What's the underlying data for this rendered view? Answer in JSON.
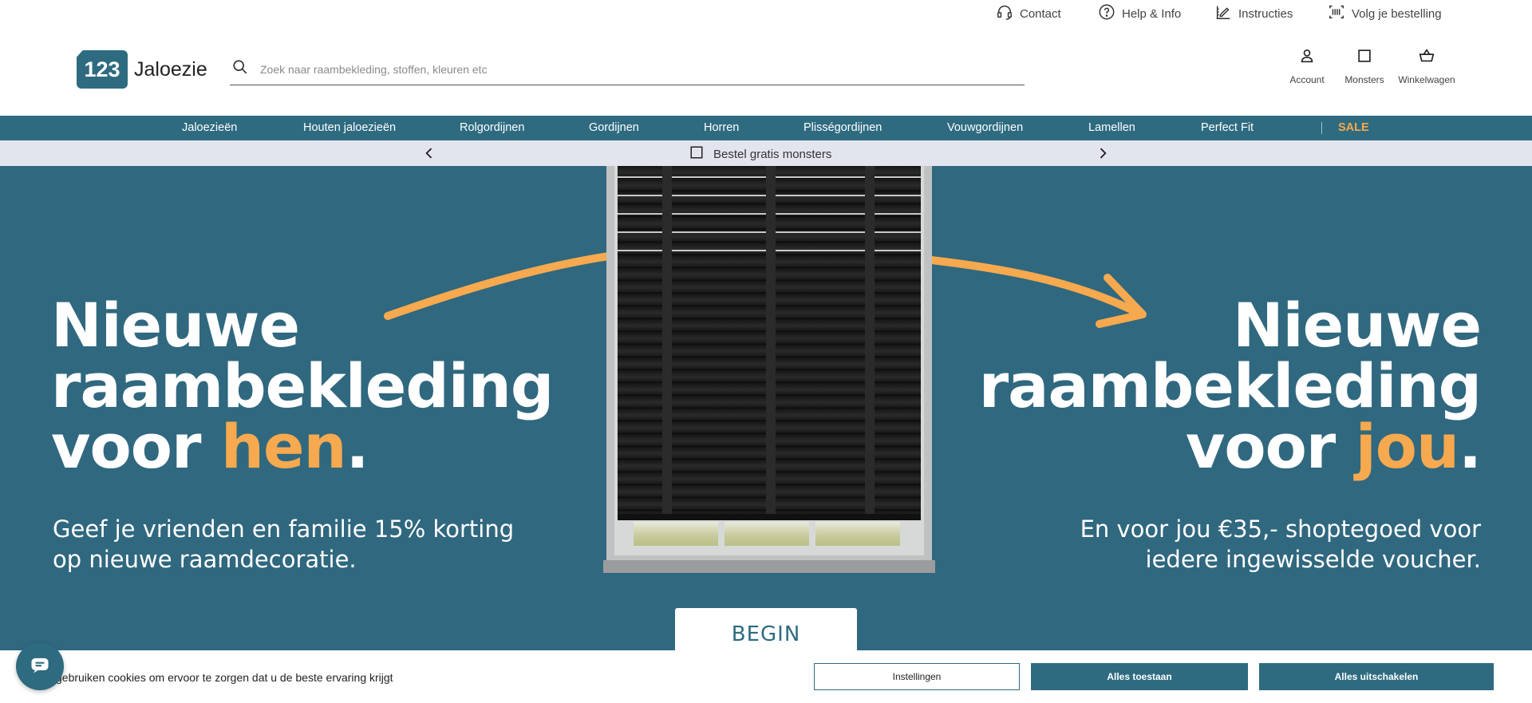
{
  "utility": {
    "contact": "Contact",
    "help": "Help & Info",
    "instructions": "Instructies",
    "track": "Volg je bestelling"
  },
  "header": {
    "logo_number": "123",
    "logo_text": "Jaloezie",
    "search_placeholder": "Zoek naar raambekleding, stoffen, kleuren etc",
    "account": "Account",
    "samples": "Monsters",
    "cart": "Winkelwagen"
  },
  "nav": {
    "items": [
      "Jaloezieën",
      "Houten jaloezieën",
      "Rolgordijnen",
      "Gordijnen",
      "Horren",
      "Plisségordijnen",
      "Vouwgordijnen",
      "Lamellen",
      "Perfect Fit"
    ],
    "sale": "SALE"
  },
  "promo": {
    "text": "Bestel gratis monsters"
  },
  "hero": {
    "left": {
      "line1": "Nieuwe",
      "line2": "raambekleding",
      "line3_prefix": "voor ",
      "line3_accent": "hen",
      "line3_suffix": ".",
      "sub1": "Geef je vrienden en familie 15% korting",
      "sub2": "op nieuwe raamdecoratie."
    },
    "right": {
      "line1": "Nieuwe",
      "line2": "raambekleding",
      "line3_prefix": "voor ",
      "line3_accent": "jou",
      "line3_suffix": ".",
      "sub1": "En voor jou €35,- shoptegoed voor",
      "sub2": "iedere ingewisselde voucher."
    },
    "cta": "BEGIN"
  },
  "cookie": {
    "text": "gebruiken cookies om ervoor te zorgen dat u de beste ervaring krijgt",
    "settings": "Instellingen",
    "allow_all": "Alles toestaan",
    "disable_all": "Alles uitschakelen"
  },
  "colors": {
    "brand": "#2e6b80",
    "accent": "#f6a94e",
    "promo_bg": "#e3e5ee"
  }
}
